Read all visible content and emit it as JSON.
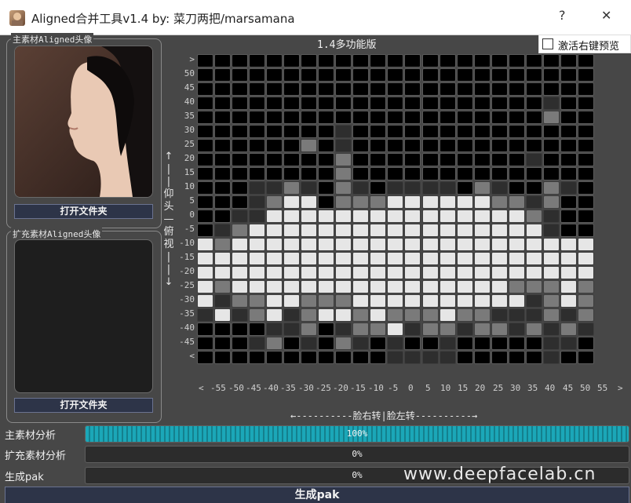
{
  "window": {
    "title": "Aligned合并工具v1.4  by:  菜刀两把/marsamana",
    "help_glyph": "?",
    "close_glyph": "✕"
  },
  "left": {
    "main_label": "主素材Aligned头像",
    "main_open_button": "打开文件夹",
    "ext_label": "扩充素材Aligned头像",
    "ext_open_button": "打开文件夹"
  },
  "header": {
    "version": "1.4多功能版",
    "preview_checkbox_label": "激活右键预览",
    "preview_checkbox_checked": false
  },
  "grid": {
    "y_labels": [
      ">",
      "50",
      "45",
      "40",
      "35",
      "30",
      "25",
      "20",
      "15",
      "10",
      "5",
      "0",
      "-5",
      "-10",
      "-15",
      "-20",
      "-25",
      "-30",
      "-35",
      "-40",
      "-45",
      "<"
    ],
    "x_labels": [
      "<",
      "-55",
      "-50",
      "-45",
      "-40",
      "-35",
      "-30",
      "-25",
      "-20",
      "-15",
      "-10",
      "-5",
      "0",
      "5",
      "10",
      "15",
      "20",
      "25",
      "30",
      "35",
      "40",
      "45",
      "50",
      "55",
      ">"
    ],
    "vertical_axis_text": [
      "↑",
      "|",
      "|",
      "仰",
      "头",
      "—",
      "俯",
      "视",
      "|",
      "|",
      "↓"
    ],
    "horizontal_axis_text": "←----------脸右转|脸左转----------→",
    "colors": {
      "0": "#000000",
      "1": "#2e2e2e",
      "2": "#7a7a7a",
      "3": "#e6e6e6"
    },
    "rows": [
      "00000000000000000000000",
      "00000000000000000000000",
      "00000000000000000000000",
      "00000000000000000000100",
      "00000000000000000000200",
      "00000000100000000000000",
      "00000020100000000000000",
      "00000000200000000001000",
      "00000000200000000000000",
      "00011210210111102100210",
      "00012330222333333221200",
      "00113333333333333332100",
      "01233333333333333333100",
      "32333333333333333333333",
      "33333333333333333333333",
      "33333333333333333333333",
      "32333333333333333322232",
      "31223322233333333331232",
      "13123123323222322111212",
      "00001120122312212212121",
      "00012010210100100000110",
      "00000000000111100000100"
    ]
  },
  "progress": [
    {
      "label": "主素材分析",
      "value": 1.0,
      "text": "100%"
    },
    {
      "label": "扩充素材分析",
      "value": 0.0,
      "text": "0%"
    },
    {
      "label": "生成pak",
      "value": 0.0,
      "text": "0%"
    }
  ],
  "watermark": "www.deepfacelab.cn",
  "generate_button": "生成pak"
}
